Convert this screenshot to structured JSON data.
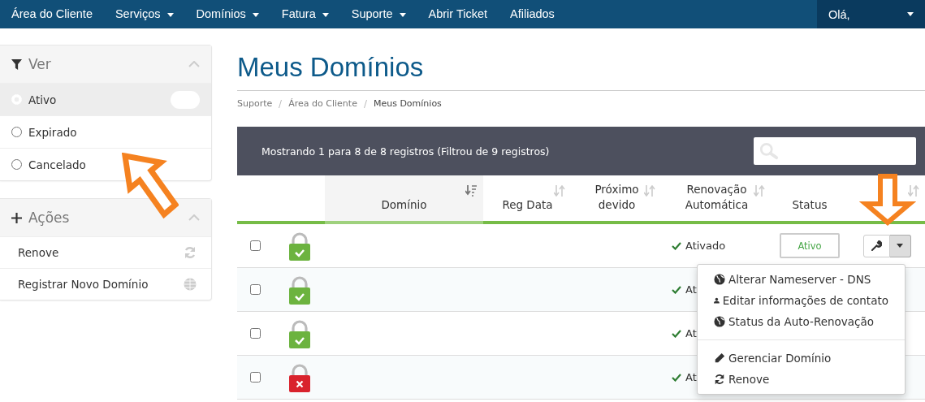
{
  "navbar": {
    "items": [
      {
        "label": "Área do Cliente",
        "dropdown": false
      },
      {
        "label": "Serviços",
        "dropdown": true
      },
      {
        "label": "Domínios",
        "dropdown": true
      },
      {
        "label": "Fatura",
        "dropdown": true
      },
      {
        "label": "Suporte",
        "dropdown": true
      },
      {
        "label": "Abrir Ticket",
        "dropdown": false
      },
      {
        "label": "Afiliados",
        "dropdown": false
      }
    ],
    "user": {
      "label": "Olá,",
      "dropdown": true
    }
  },
  "sidebar": {
    "panels": [
      {
        "title": "Ver",
        "kind": "filter",
        "items": [
          {
            "label": "Ativo",
            "selected": true
          },
          {
            "label": "Expirado",
            "selected": false
          },
          {
            "label": "Cancelado",
            "selected": false
          }
        ]
      },
      {
        "title": "Ações",
        "kind": "actions",
        "items": [
          {
            "label": "Renove",
            "kind": "refresh"
          },
          {
            "label": "Registrar Novo Domínio",
            "kind": "globe"
          }
        ]
      }
    ]
  },
  "page_title": "Meus Domínios",
  "breadcrumb": [
    {
      "label": "Suporte",
      "current": false
    },
    {
      "label": "Área do Cliente",
      "current": false
    },
    {
      "label": "Meus Domínios",
      "current": true
    }
  ],
  "table": {
    "summary": "Mostrando 1 para 8 de 8 registros (Filtrou de 9 registros)",
    "columns": [
      {
        "sortable": false,
        "sorted": false
      },
      {
        "sortable": false,
        "sorted": false
      },
      {
        "label": "Domínio",
        "sortable": true,
        "sorted": true
      },
      {
        "label": "Reg Data",
        "sortable": true,
        "sorted": false
      },
      {
        "label": "Próximo devido",
        "sortable": true,
        "sorted": false
      },
      {
        "label": "Renovação Automática",
        "sortable": true,
        "sorted": false
      },
      {
        "label": "Status",
        "sortable": false,
        "sorted": false
      },
      {
        "sortable": true,
        "sorted": false
      }
    ],
    "rows": [
      {
        "checked": false,
        "ssl_valid": true,
        "autorenew": "Ativado",
        "status": "Ativo",
        "actions": true
      },
      {
        "checked": false,
        "ssl_valid": true,
        "autorenew": "Ati",
        "actions": false
      },
      {
        "checked": false,
        "ssl_valid": true,
        "autorenew": "Ati",
        "actions": false
      },
      {
        "checked": false,
        "ssl_valid": false,
        "autorenew": "Ati",
        "actions": false
      }
    ]
  },
  "dropdown_menu": {
    "groups": [
      [
        {
          "label": "Alterar Nameserver - DNS",
          "kind": "globe"
        },
        {
          "label": "Editar informações de contato",
          "kind": "user"
        },
        {
          "label": "Status da Auto-Renovação",
          "kind": "globe"
        }
      ],
      [
        {
          "label": "Gerenciar Domínio",
          "kind": "pencil"
        },
        {
          "label": "Renove",
          "kind": "refresh"
        }
      ]
    ]
  }
}
